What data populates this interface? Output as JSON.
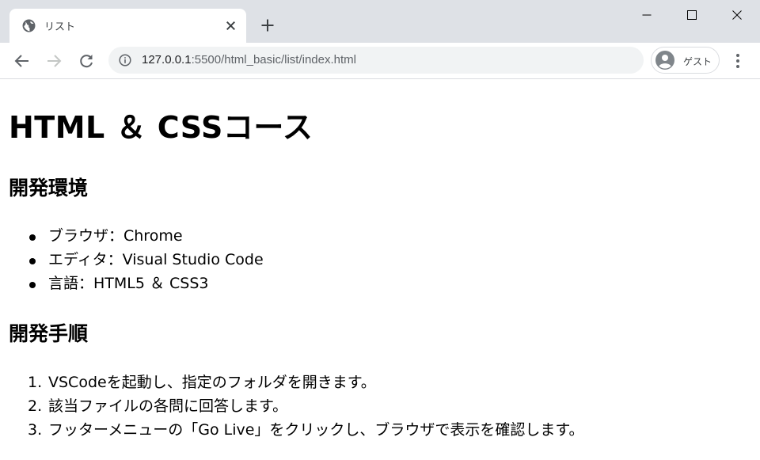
{
  "browser": {
    "tab": {
      "title": "リスト"
    },
    "url": {
      "host": "127.0.0.1",
      "path": ":5500/html_basic/list/index.html"
    },
    "profile": {
      "label": "ゲスト"
    }
  },
  "page": {
    "h1": "HTML ＆ CSSコース",
    "env_heading": "開発環境",
    "env_items": [
      {
        "text": "ブラウザ：Chrome"
      },
      {
        "text": "エディタ：Visual Studio Code"
      },
      {
        "text": "言語：HTML5 ＆ CSS3"
      }
    ],
    "proc_heading": "開発手順",
    "proc_items": [
      {
        "num": "1.",
        "text": "VSCodeを起動し、指定のフォルダを開きます。"
      },
      {
        "num": "2.",
        "text": "該当ファイルの各問に回答します。"
      },
      {
        "num": "3.",
        "text": "フッターメニューの「Go Live」をクリックし、ブラウザで表示を確認します。"
      }
    ]
  },
  "icons": {
    "favicon": "globe-icon",
    "close": "close-icon",
    "new_tab": "plus-icon",
    "back": "arrow-left-icon",
    "forward": "arrow-right-icon",
    "reload": "reload-icon",
    "info": "info-icon",
    "avatar": "avatar-icon",
    "menu": "kebab-menu-icon"
  }
}
